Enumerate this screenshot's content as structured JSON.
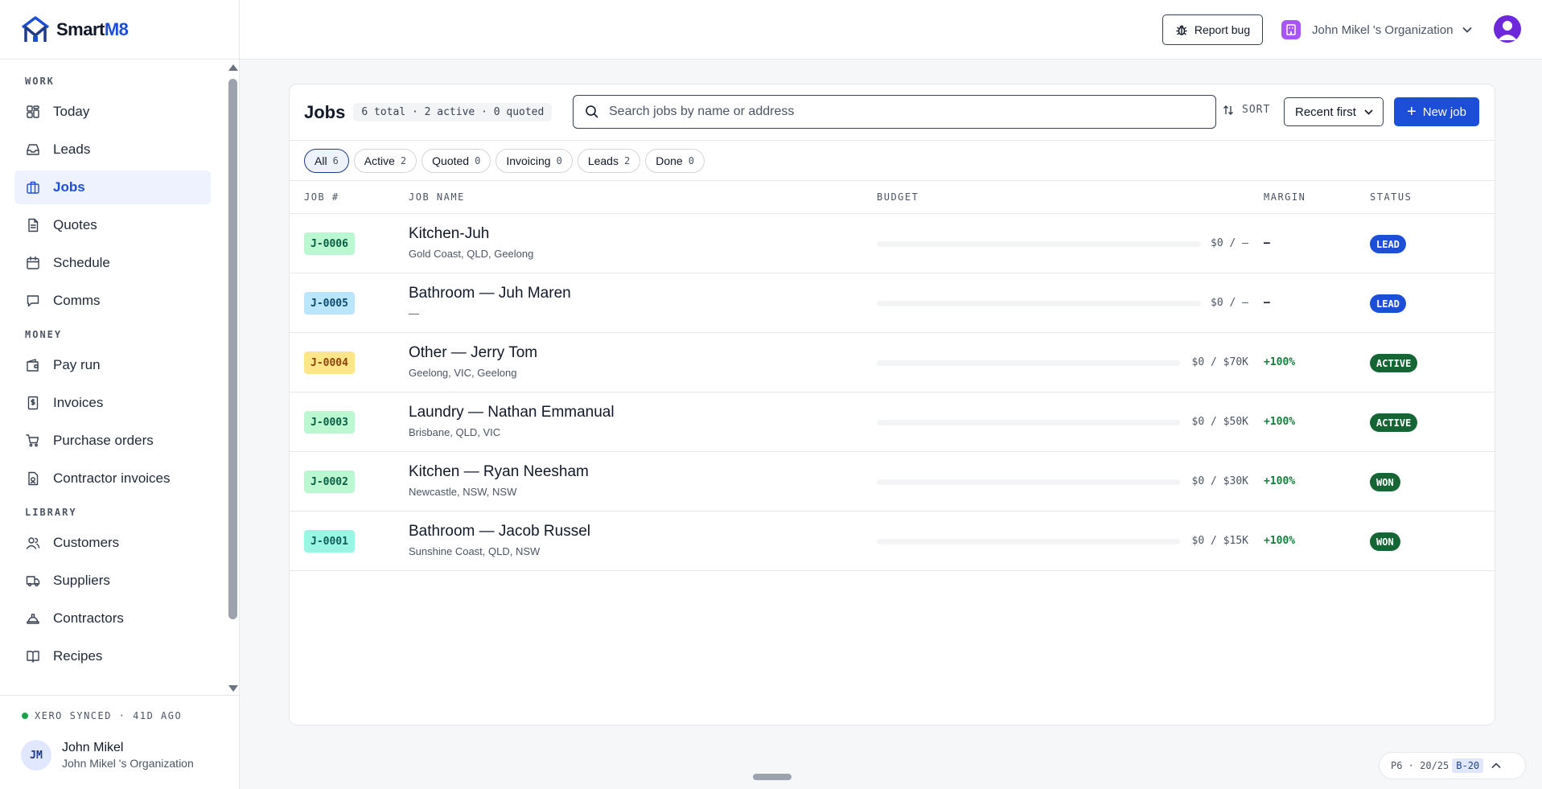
{
  "brand": {
    "name_main": "Smart",
    "name_accent": "M8"
  },
  "sidebar": {
    "sections": [
      {
        "title": "WORK",
        "items": [
          {
            "label": "Today",
            "icon": "grid-icon"
          },
          {
            "label": "Leads",
            "icon": "inbox-icon"
          },
          {
            "label": "Jobs",
            "icon": "briefcase-icon",
            "active": true
          },
          {
            "label": "Quotes",
            "icon": "document-icon"
          },
          {
            "label": "Schedule",
            "icon": "calendar-icon"
          },
          {
            "label": "Comms",
            "icon": "chat-icon"
          }
        ]
      },
      {
        "title": "MONEY",
        "items": [
          {
            "label": "Pay run",
            "icon": "wallet-icon"
          },
          {
            "label": "Invoices",
            "icon": "invoice-icon"
          },
          {
            "label": "Purchase orders",
            "icon": "cart-icon"
          },
          {
            "label": "Contractor invoices",
            "icon": "contractor-invoice-icon"
          }
        ]
      },
      {
        "title": "LIBRARY",
        "items": [
          {
            "label": "Customers",
            "icon": "users-icon"
          },
          {
            "label": "Suppliers",
            "icon": "truck-icon"
          },
          {
            "label": "Contractors",
            "icon": "hardhat-icon"
          },
          {
            "label": "Recipes",
            "icon": "book-icon"
          }
        ]
      }
    ],
    "sync_status": "XERO SYNCED · 41D AGO",
    "user": {
      "initials": "JM",
      "name": "John Mikel",
      "org": "John Mikel 's Organization"
    }
  },
  "topbar": {
    "report_bug": "Report bug",
    "org_name": "John Mikel 's Organization"
  },
  "jobs": {
    "title": "Jobs",
    "summary": "6 total · 2 active · 0 quoted",
    "search_placeholder": "Search jobs by name or address",
    "sort_label": "SORT",
    "sort_value": "Recent first",
    "new_job": "New job",
    "filters": [
      {
        "label": "All",
        "count": "6",
        "active": true
      },
      {
        "label": "Active",
        "count": "2"
      },
      {
        "label": "Quoted",
        "count": "0"
      },
      {
        "label": "Invoicing",
        "count": "0"
      },
      {
        "label": "Leads",
        "count": "2"
      },
      {
        "label": "Done",
        "count": "0"
      }
    ],
    "columns": {
      "job_no": "JOB #",
      "job_name": "JOB NAME",
      "budget": "BUDGET",
      "margin": "MARGIN",
      "status": "STATUS"
    },
    "rows": [
      {
        "no": "J-0006",
        "name": "Kitchen-Juh",
        "address": "Gold Coast, QLD, Geelong",
        "budget": "$0 / —",
        "margin": "—",
        "status": "LEAD",
        "tag_bg": "#bbf7d0",
        "tag_fg": "#065f46",
        "status_color": "#1d4ed8",
        "margin_color": "#111827"
      },
      {
        "no": "J-0005",
        "name": "Bathroom — Juh Maren",
        "address": "—",
        "budget": "$0 / —",
        "margin": "—",
        "status": "LEAD",
        "tag_bg": "#bae6fd",
        "tag_fg": "#0c4a6e",
        "status_color": "#1d4ed8",
        "margin_color": "#111827"
      },
      {
        "no": "J-0004",
        "name": "Other — Jerry Tom",
        "address": "Geelong, VIC, Geelong",
        "budget": "$0 / $70K",
        "margin": "+100%",
        "status": "ACTIVE",
        "tag_bg": "#fde68a",
        "tag_fg": "#92400e",
        "status_color": "#166534",
        "margin_color": "#15803d"
      },
      {
        "no": "J-0003",
        "name": "Laundry — Nathan Emmanual",
        "address": "Brisbane, QLD, VIC",
        "budget": "$0 / $50K",
        "margin": "+100%",
        "status": "ACTIVE",
        "tag_bg": "#bbf7d0",
        "tag_fg": "#065f46",
        "status_color": "#166534",
        "margin_color": "#15803d"
      },
      {
        "no": "J-0002",
        "name": "Kitchen — Ryan Neesham",
        "address": "Newcastle, NSW, NSW",
        "budget": "$0 / $30K",
        "margin": "+100%",
        "status": "WON",
        "tag_bg": "#bbf7d0",
        "tag_fg": "#065f46",
        "status_color": "#166534",
        "margin_color": "#15803d"
      },
      {
        "no": "J-0001",
        "name": "Bathroom — Jacob Russel",
        "address": "Sunshine Coast, QLD, NSW",
        "budget": "$0 / $15K",
        "margin": "+100%",
        "status": "WON",
        "tag_bg": "#99f6e4",
        "tag_fg": "#115e59",
        "status_color": "#166534",
        "margin_color": "#15803d"
      }
    ]
  },
  "pager": {
    "text": "P6 · 20/25",
    "badge": "B-20"
  }
}
